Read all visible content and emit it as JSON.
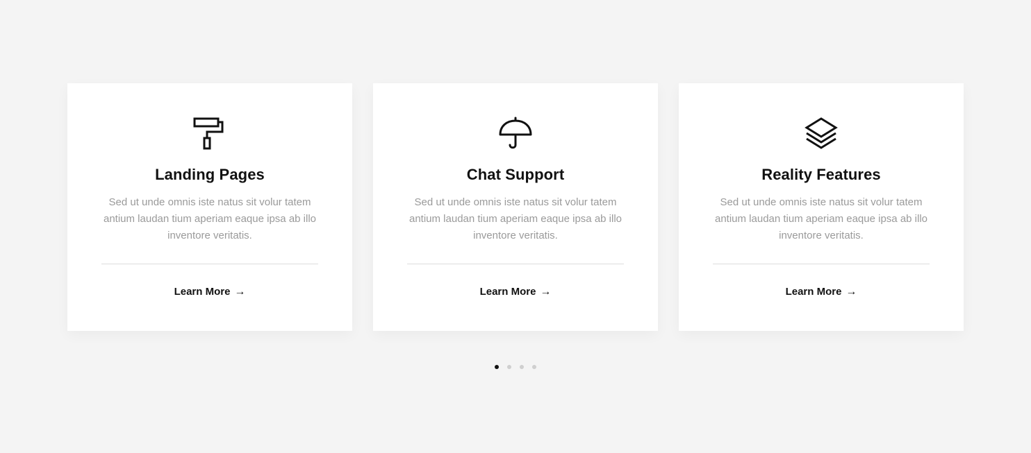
{
  "cards": [
    {
      "icon": "paint-roller-icon",
      "title": "Landing Pages",
      "description": "Sed ut unde omnis iste natus sit volur tatem antium laudan tium aperiam eaque ipsa ab illo inventore veritatis.",
      "cta": "Learn More"
    },
    {
      "icon": "umbrella-icon",
      "title": "Chat Support",
      "description": "Sed ut unde omnis iste natus sit volur tatem antium laudan tium aperiam eaque ipsa ab illo inventore veritatis.",
      "cta": "Learn More"
    },
    {
      "icon": "layers-icon",
      "title": "Reality Features",
      "description": "Sed ut unde omnis iste natus sit volur tatem antium laudan tium aperiam eaque ipsa ab illo inventore veritatis.",
      "cta": "Learn More"
    }
  ],
  "pagination": {
    "total": 4,
    "active": 1
  },
  "colors": {
    "background": "#f4f4f4",
    "card": "#ffffff",
    "heading": "#111111",
    "body_text": "#9a9a9a",
    "dot_inactive": "#cfcfcf",
    "dot_active": "#111111"
  }
}
